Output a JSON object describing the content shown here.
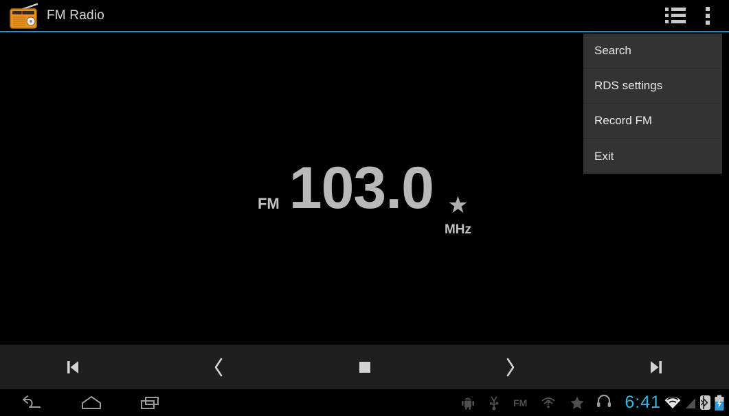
{
  "app": {
    "title": "FM Radio",
    "icon": "radio-icon",
    "accent_color": "#2a8fc4"
  },
  "action_bar": {
    "stations_icon": "list-icon",
    "overflow_icon": "overflow-menu-icon"
  },
  "overflow_menu": {
    "visible": true,
    "background_color": "#333333",
    "items": [
      {
        "label": "Search",
        "name": "menu-item-search"
      },
      {
        "label": "RDS settings",
        "name": "menu-item-rds-settings"
      },
      {
        "label": "Record FM",
        "name": "menu-item-record-fm"
      },
      {
        "label": "Exit",
        "name": "menu-item-exit"
      }
    ]
  },
  "tuner": {
    "band": "FM",
    "frequency": "103.0",
    "unit": "MHz",
    "favorite_star": "★",
    "text_color": "#b9b9b9"
  },
  "controls": [
    {
      "name": "previous-station-button",
      "icon": "skip-previous-icon"
    },
    {
      "name": "tune-down-button",
      "icon": "chevron-left-icon"
    },
    {
      "name": "stop-button",
      "icon": "stop-icon"
    },
    {
      "name": "tune-up-button",
      "icon": "chevron-right-icon"
    },
    {
      "name": "next-station-button",
      "icon": "skip-next-icon"
    }
  ],
  "system_bar": {
    "nav_keys": [
      {
        "name": "back-button",
        "icon": "back-arrow-icon"
      },
      {
        "name": "home-button",
        "icon": "home-icon"
      },
      {
        "name": "recents-button",
        "icon": "recent-apps-icon"
      }
    ],
    "notifications": [
      {
        "name": "android-debug-icon",
        "icon": "android-debug-icon"
      },
      {
        "name": "usb-icon",
        "icon": "usb-icon"
      },
      {
        "name": "fm-notification-icon",
        "icon": "fm-text-icon",
        "label": "FM"
      },
      {
        "name": "wifi-unknown-icon",
        "icon": "wifi-question-icon"
      },
      {
        "name": "star-notification-icon",
        "icon": "star-icon"
      }
    ],
    "clock": "6:41",
    "clock_color": "#33b5e5",
    "status_icons": [
      {
        "name": "headphones-icon",
        "icon": "headphones-icon"
      },
      {
        "name": "wifi-icon",
        "icon": "wifi-icon"
      },
      {
        "name": "cell-signal-icon",
        "icon": "signal-triangle-icon"
      },
      {
        "name": "bluetooth-icon",
        "icon": "bluetooth-icon"
      },
      {
        "name": "battery-charging-icon",
        "icon": "battery-charging-icon"
      }
    ]
  }
}
